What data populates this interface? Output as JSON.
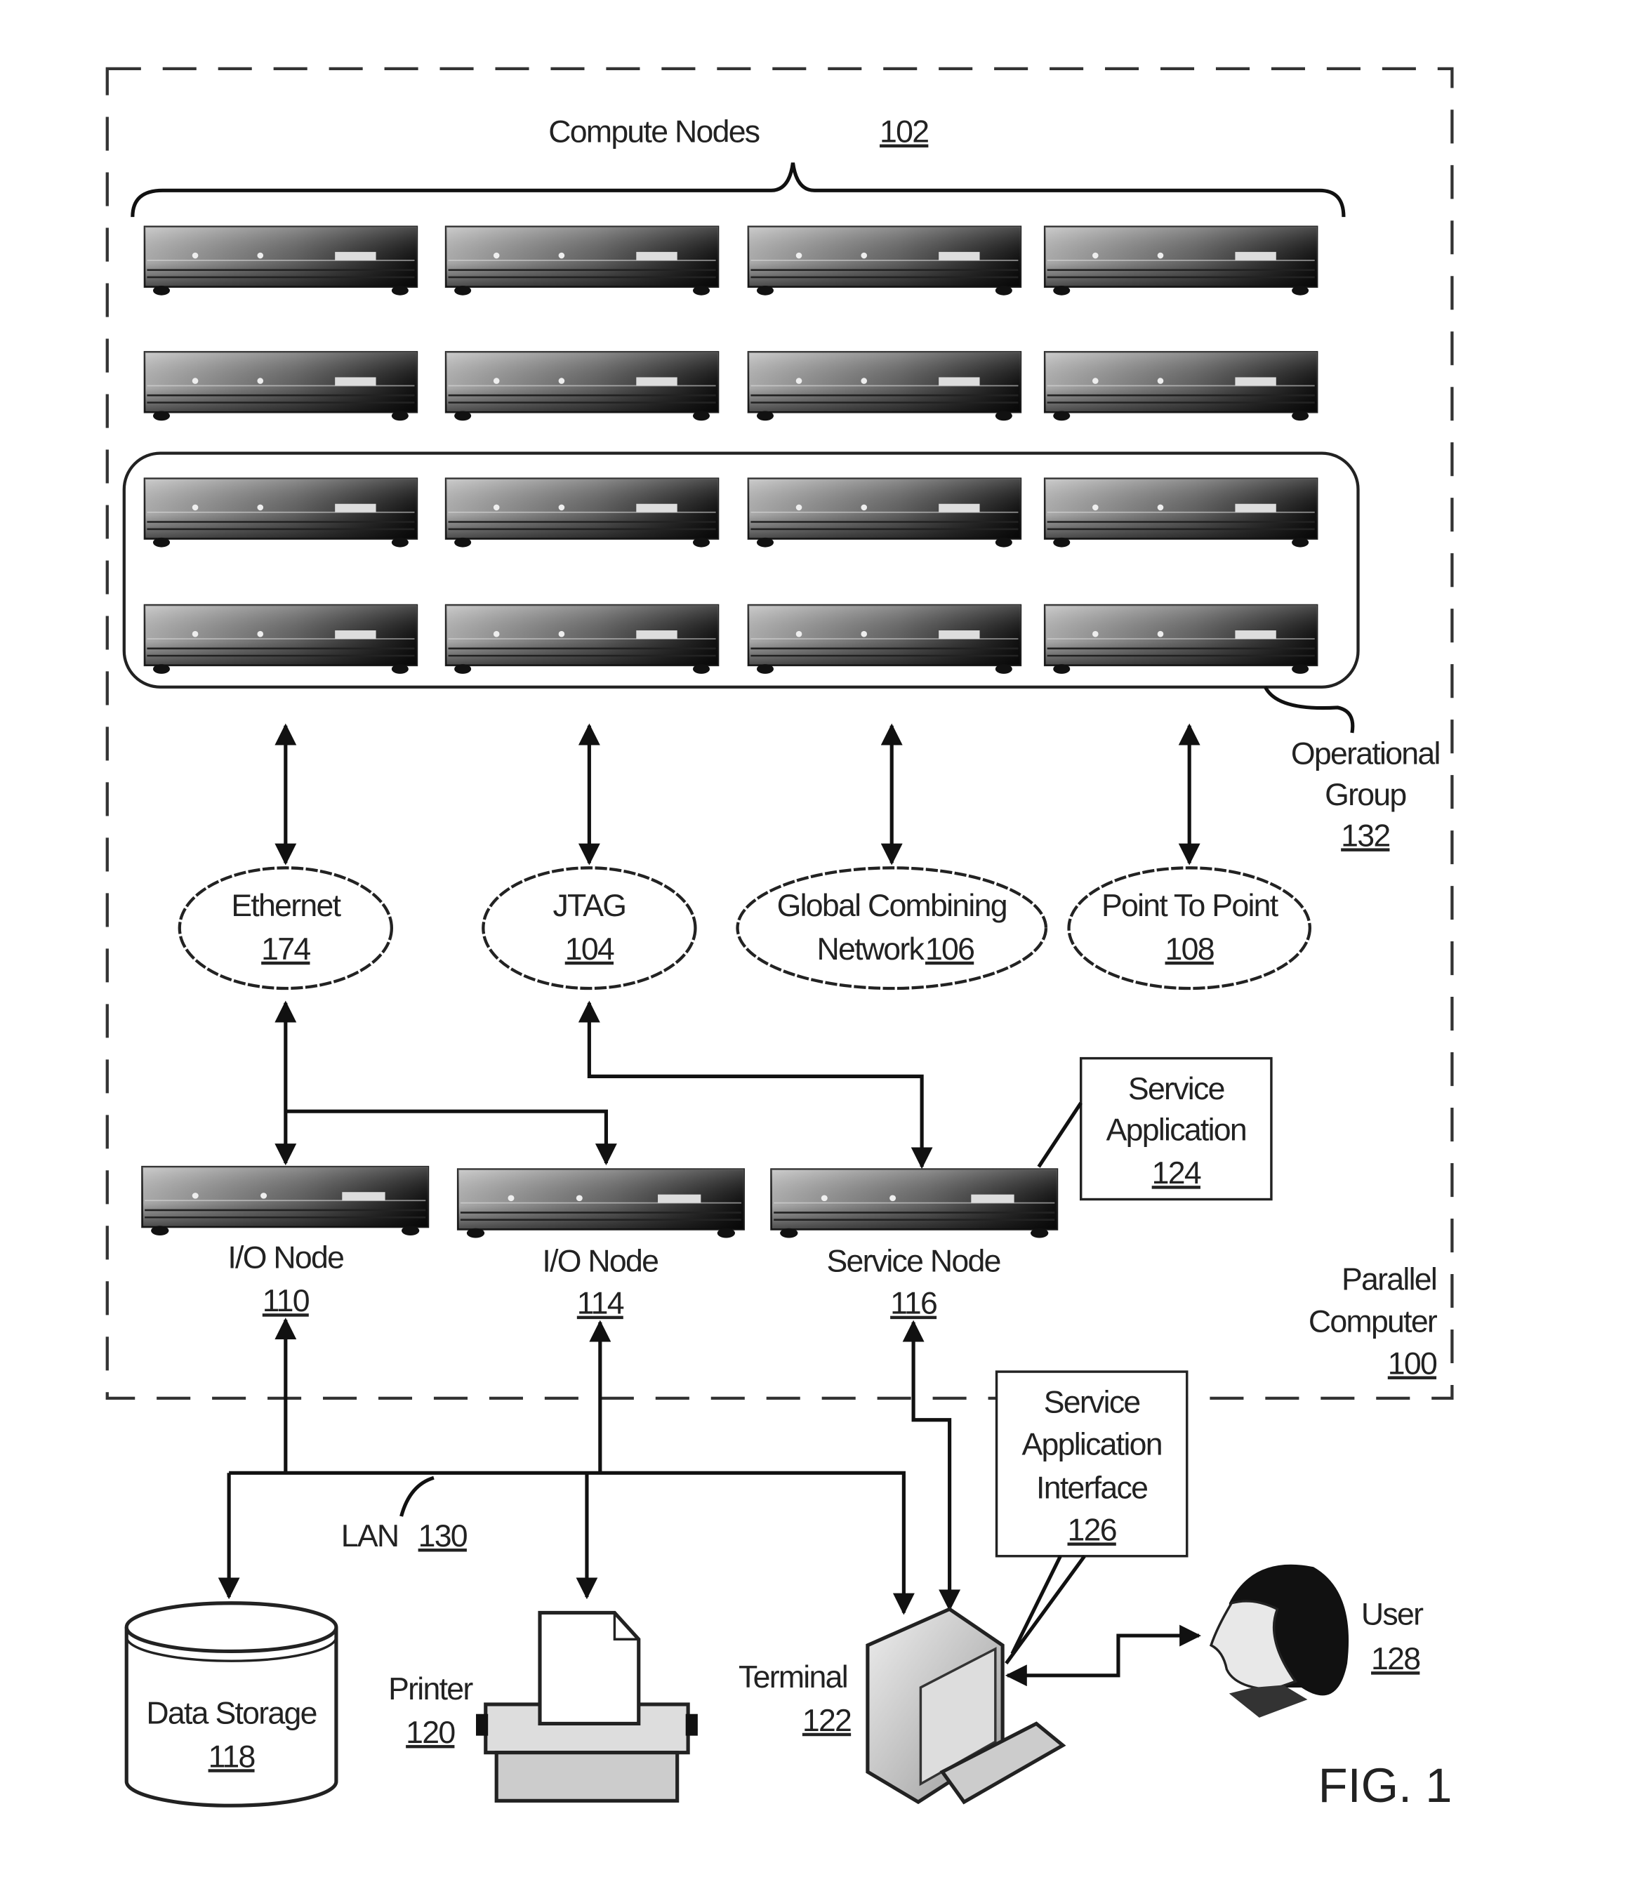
{
  "figure": {
    "caption": "FIG. 1",
    "parallel_computer": {
      "label_lines": [
        "Parallel",
        "Computer"
      ],
      "ref": "100"
    },
    "compute_nodes": {
      "label": "Compute Nodes",
      "ref": "102",
      "rows": 4,
      "cols": 4
    },
    "operational_group": {
      "label_lines": [
        "Operational",
        "Group"
      ],
      "ref": "132"
    },
    "networks": [
      {
        "id": "ethernet",
        "label_lines": [
          "Ethernet"
        ],
        "ref": "174"
      },
      {
        "id": "jtag",
        "label_lines": [
          "JTAG"
        ],
        "ref": "104"
      },
      {
        "id": "global-combining",
        "label_lines": [
          "Global Combining",
          "Network"
        ],
        "ref": "106"
      },
      {
        "id": "point-to-point",
        "label_lines": [
          "Point To Point"
        ],
        "ref": "108"
      }
    ],
    "nodes": [
      {
        "id": "io-node-1",
        "label": "I/O Node",
        "ref": "110"
      },
      {
        "id": "io-node-2",
        "label": "I/O Node",
        "ref": "114"
      },
      {
        "id": "service-node",
        "label": "Service Node",
        "ref": "116"
      }
    ],
    "service_application": {
      "label_lines": [
        "Service",
        "Application"
      ],
      "ref": "124"
    },
    "service_application_interface": {
      "label_lines": [
        "Service",
        "Application",
        "Interface"
      ],
      "ref": "126"
    },
    "lan": {
      "label": "LAN",
      "ref": "130"
    },
    "data_storage": {
      "label": "Data Storage",
      "ref": "118"
    },
    "printer": {
      "label": "Printer",
      "ref": "120"
    },
    "terminal": {
      "label": "Terminal",
      "ref": "122"
    },
    "user": {
      "label": "User",
      "ref": "128"
    }
  }
}
